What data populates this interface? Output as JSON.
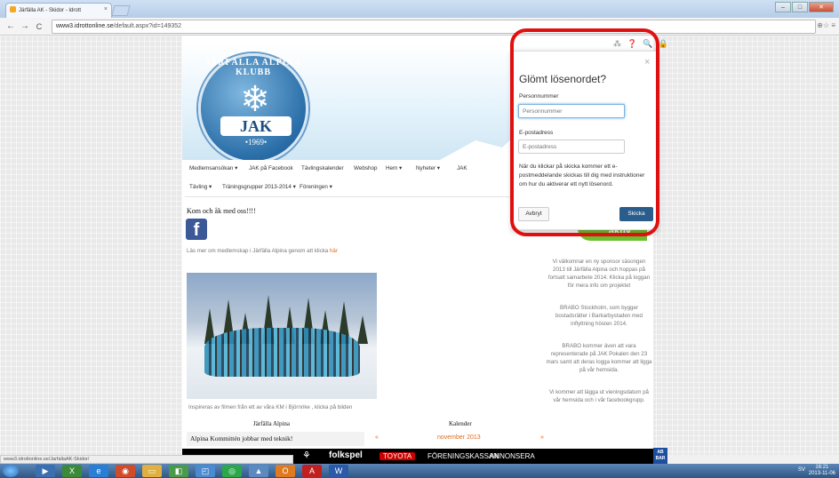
{
  "browser": {
    "tab_title": "Järfälla AK - Skidor - Idrott",
    "tab_close": "×",
    "url_prefix": "www3.idrottonline.se",
    "url_rest": "/default.aspx?id=149352",
    "back": "←",
    "forward": "→",
    "reload": "C",
    "right_tools": "⊕☆ ≡",
    "win_min": "–",
    "win_max": "□",
    "win_close": "✕"
  },
  "logo": {
    "arc_text": "JÄRFÄLLA ALPINA KLUBB",
    "initials": "JAK",
    "year": "•1969•",
    "flake": "❄"
  },
  "nav": {
    "row1": [
      "Medlemsansökan ▾",
      "JAK på Facebook",
      "Tävlingskalender",
      "Webshop",
      "Hem ▾",
      "Nyheter ▾",
      "JAK"
    ],
    "row2": [
      "Tävling ▾",
      "Träningsgrupper 2013-2014 ▾",
      "Föreningen ▾"
    ]
  },
  "main": {
    "heading": "Kom och åk med oss!!!!",
    "fb_letter": "f",
    "read_more": "Läs mer om medlemskap i Järfälla Alpina genom att klicka ",
    "read_more_link": "här",
    "photo_caption": "Inspireras av filmen från ett av våra KM i Björnrike , klicka på bilden",
    "col1_heading": "Järfälla Alpina",
    "col2_heading": "Kalender",
    "news_item": "Alpina Kommittén jobbar med teknik!",
    "calendar": {
      "month": "november 2013",
      "prev": "«",
      "next": "»"
    }
  },
  "sidebar": {
    "green_badge": "aktiv",
    "paragraphs": [
      "Vi välkomnar en ny sponsor säsongen 2013 till Järfälla Alpina och hoppas på fortsatt samarbete 2014. Klicka på loggan för mera info om projektet",
      "BRABO Stockholm, som bygger bostadsrätter i Barkarbystaden med inflyttning hösten 2014.",
      "BRABO kommer även att vara representerade på JAK Pokalen den  23 mars samt att deras logga kommer att ligga på vår hemsida.",
      "Vi kommer att lägga ut vieningsdatum på vår hemsida och i vår facebookgrupp."
    ]
  },
  "modal": {
    "tools": "⁂ ❓ 🔍 🔒",
    "title": "Glömt lösenordet?",
    "close": "×",
    "personnummer_label": "Personnummer",
    "personnummer_placeholder": "Personnummer",
    "email_label": "E-postadress",
    "email_placeholder": "E-postadress",
    "message": "När du klickar på skicka kommer ett e-postmeddelande skickas till dig med instruktioner om hur du aktiverar ett nytt lösenord.",
    "cancel": "Avbryt",
    "submit": "Skicka",
    "highlight_color": "#e01010"
  },
  "footer": {
    "folkspel": "folkspel",
    "toyota": "TOYOTA",
    "foreningskassan": "FÖRENINGSKASSAN",
    "annonsera": "ANNONSERA",
    "ab": "AB BAR",
    "status_url": "www3.idrottonline.se/JarfallaAK-Skidor/"
  },
  "taskbar": {
    "lang": "SV",
    "time": "16:21",
    "date": "2013-11-06"
  }
}
